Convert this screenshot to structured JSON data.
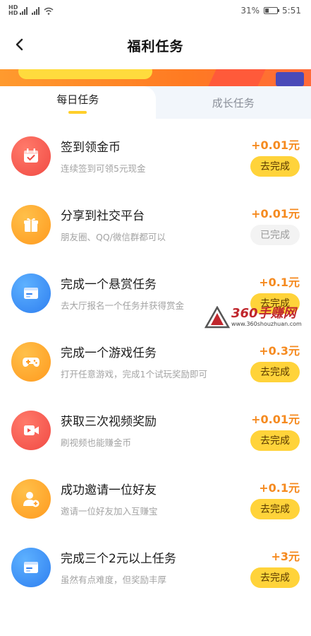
{
  "status": {
    "battery": "31%",
    "time": "5:51",
    "battery_level": 0.31
  },
  "header": {
    "title": "福利任务"
  },
  "tabs": [
    {
      "label": "每日任务",
      "active": true
    },
    {
      "label": "成长任务",
      "active": false
    }
  ],
  "tasks": [
    {
      "title": "签到领金币",
      "desc": "连续签到可领5元现金",
      "reward": "+0.01元",
      "button": "去完成",
      "icon": "calendar-icon",
      "color": "#f14a44"
    },
    {
      "title": "分享到社交平台",
      "desc": "朋友圈、QQ/微信群都可以",
      "reward": "+0.01元",
      "button": "已完成",
      "icon": "gift-icon",
      "color": "#ff9a1e"
    },
    {
      "title": "完成一个悬赏任务",
      "desc": "去大厅报名一个任务并获得赏金",
      "reward": "+0.1元",
      "button": "去完成",
      "icon": "card-icon",
      "color": "#2f7ff0"
    },
    {
      "title": "完成一个游戏任务",
      "desc": "打开任意游戏，完成1个试玩奖励即可",
      "reward": "+0.3元",
      "button": "去完成",
      "icon": "gamepad-icon",
      "color": "#ff9a1e"
    },
    {
      "title": "获取三次视频奖励",
      "desc": "刷视频也能赚金币",
      "reward": "+0.01元",
      "button": "去完成",
      "icon": "video-icon",
      "color": "#f14a44"
    },
    {
      "title": "成功邀请一位好友",
      "desc": "邀请一位好友加入互赚宝",
      "reward": "+0.1元",
      "button": "去完成",
      "icon": "add-user-icon",
      "color": "#ff9a1e"
    },
    {
      "title": "完成三个2元以上任务",
      "desc": "虽然有点难度，但奖励丰厚",
      "reward": "+3元",
      "button": "去完成",
      "icon": "card-icon",
      "color": "#2f7ff0"
    }
  ],
  "watermark": {
    "main": "360手赚网",
    "sub": "www.360shouzhuan.com"
  }
}
